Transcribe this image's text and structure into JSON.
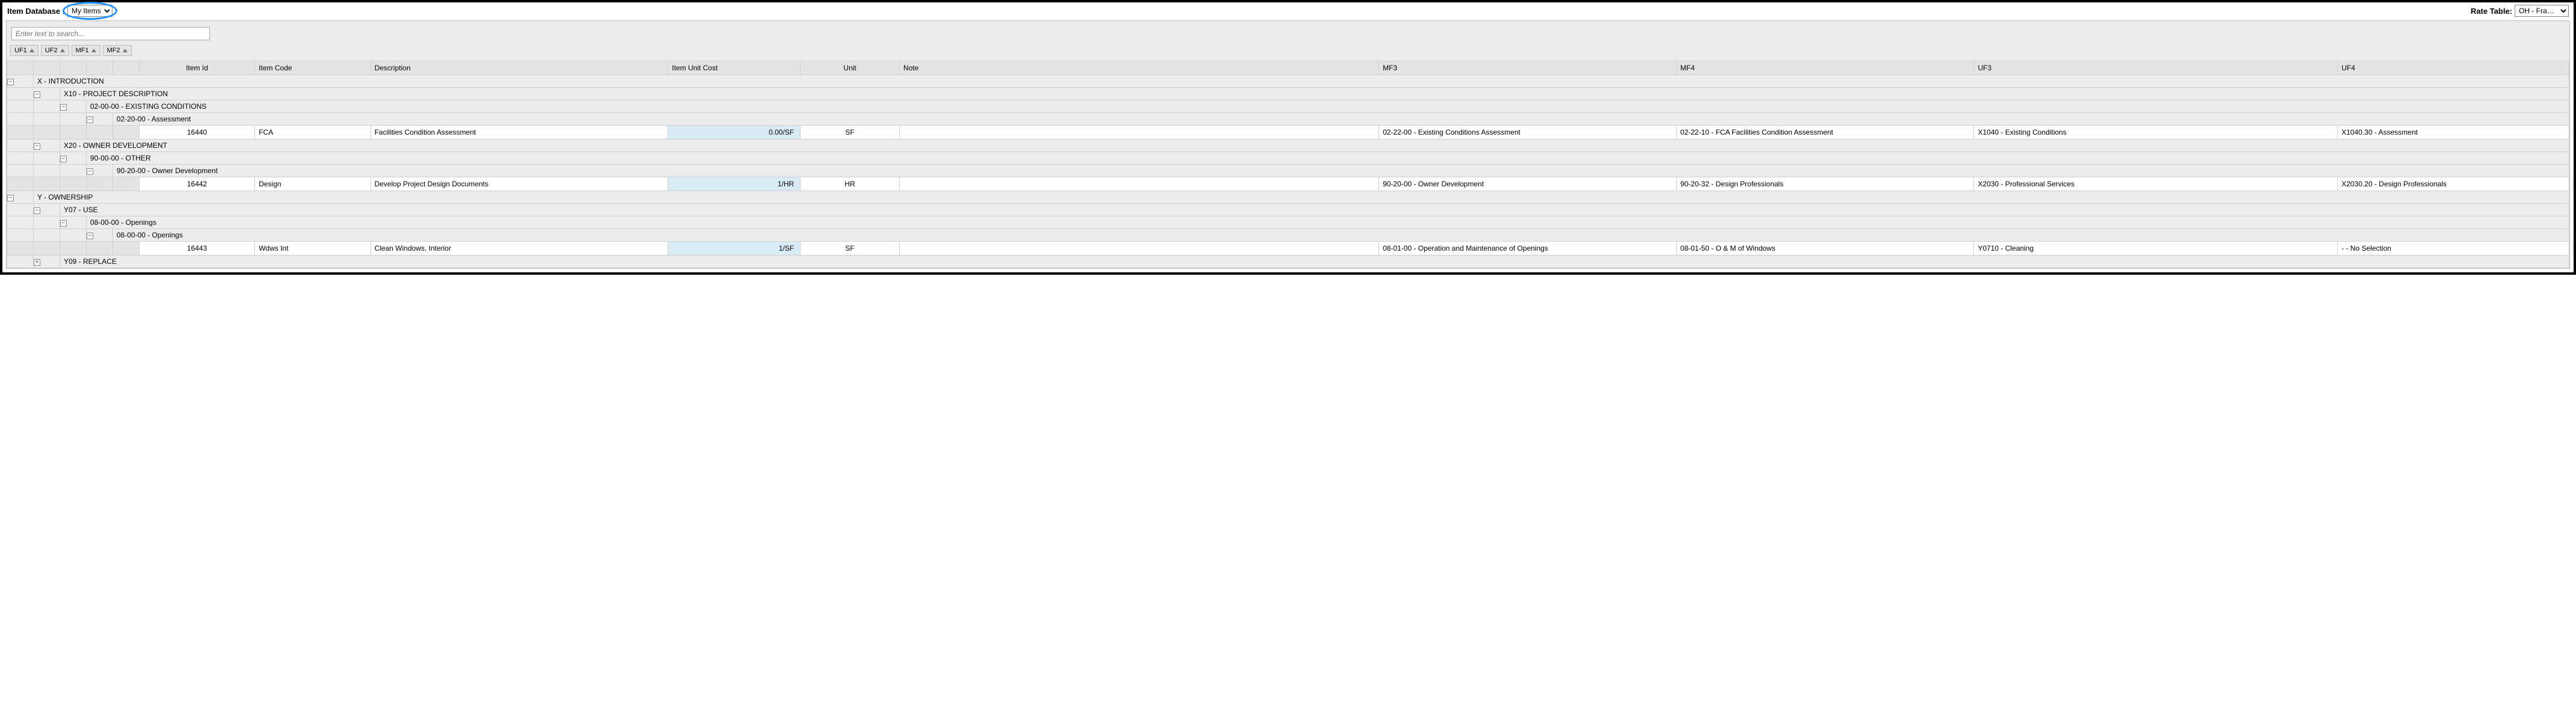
{
  "topbar": {
    "db_label": "Item Database :",
    "db_value": "My Items",
    "rate_label": "Rate Table:",
    "rate_value": "OH - Franklin (P"
  },
  "search": {
    "placeholder": "Enter text to search..."
  },
  "group_chips": [
    "UF1",
    "UF2",
    "MF1",
    "MF2"
  ],
  "columns": {
    "item_id": "Item Id",
    "item_code": "Item Code",
    "description": "Description",
    "item_unit_cost": "Item Unit Cost",
    "unit": "Unit",
    "note": "Note",
    "mf3": "MF3",
    "mf4": "MF4",
    "uf3": "UF3",
    "uf4": "UF4"
  },
  "groups": {
    "x": "X - INTRODUCTION",
    "x10": "X10 - PROJECT DESCRIPTION",
    "x10a": "02-00-00 - EXISTING CONDITIONS",
    "x10b": "02-20-00 - Assessment",
    "x20": "X20 - OWNER DEVELOPMENT",
    "x20a": "90-00-00 - OTHER",
    "x20b": "90-20-00 - Owner Development",
    "y": "Y - OWNERSHIP",
    "y07": "Y07 - USE",
    "y07a": "08-00-00 - Openings",
    "y07b": "08-00-00 - Openings",
    "y09": "Y09 - REPLACE"
  },
  "rows": {
    "r1": {
      "item_id": "16440",
      "item_code": "FCA",
      "description": "Facilities Condition Assessment",
      "cost": "0.00/SF",
      "unit": "SF",
      "note": "",
      "mf3": "02-22-00 - Existing Conditions Assessment",
      "mf4": "02-22-10 - FCA Facilities Condition Assessment",
      "uf3": "X1040 - Existing Conditions",
      "uf4": "X1040.30 - Assessment"
    },
    "r2": {
      "item_id": "16442",
      "item_code": "Design",
      "description": "Develop Project Design Documents",
      "cost": "1/HR",
      "unit": "HR",
      "note": "",
      "mf3": "90-20-00 - Owner Development",
      "mf4": "90-20-32 - Design Professionals",
      "uf3": "X2030 - Professional Services",
      "uf4": "X2030.20 - Design Professionals"
    },
    "r3": {
      "item_id": "16443",
      "item_code": "Wdws Int",
      "description": "Clean Windows, Interior",
      "cost": "1/SF",
      "unit": "SF",
      "note": "",
      "mf3": "08-01-00 - Operation and Maintenance of Openings",
      "mf4": "08-01-50 - O & M of Windows",
      "uf3": "Y0710 - Cleaning",
      "uf4": "- - No Selection"
    }
  }
}
